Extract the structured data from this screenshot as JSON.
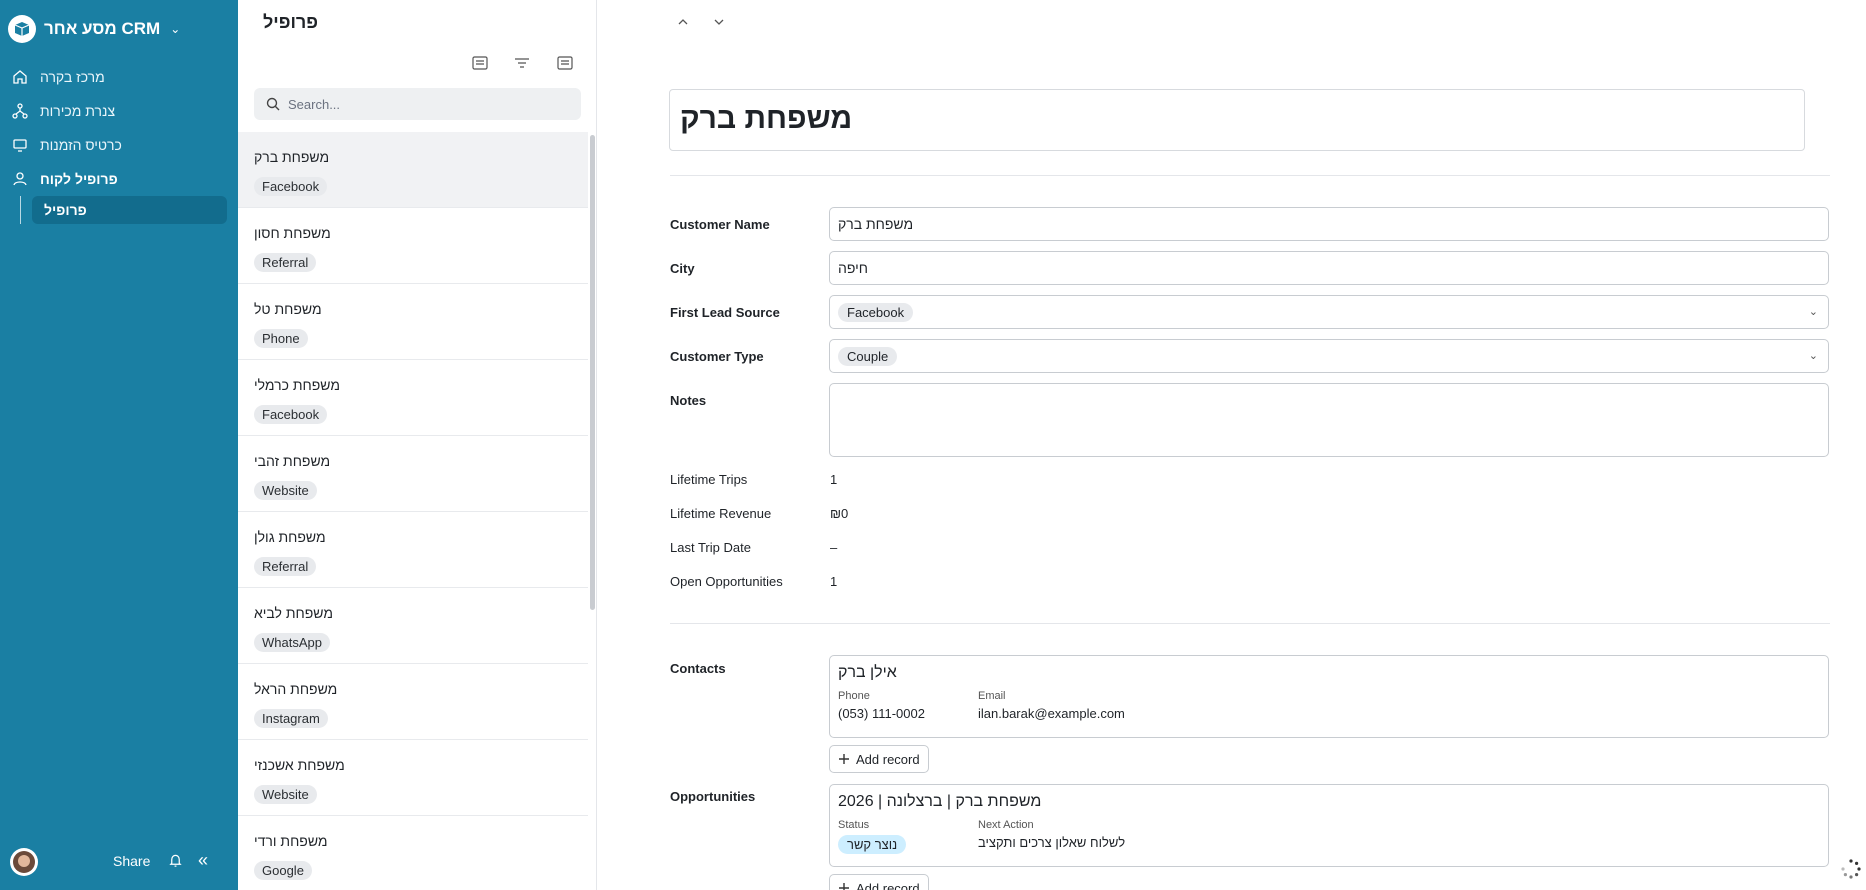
{
  "workspace": {
    "title": "מסע אחר CRM"
  },
  "nav": {
    "items": [
      {
        "label": "מרכז בקרה",
        "icon": "home-icon"
      },
      {
        "label": "צנרת מכירות",
        "icon": "pipeline-icon"
      },
      {
        "label": "כרטיס הזמנות",
        "icon": "monitor-icon"
      },
      {
        "label": "פרופיל לקוח",
        "icon": "user-icon"
      }
    ],
    "subitem": "פרופיל"
  },
  "footer": {
    "share": "Share"
  },
  "list": {
    "title": "פרופיל",
    "search_placeholder": "Search...",
    "items": [
      {
        "name": "משפחת ברק",
        "tag": "Facebook"
      },
      {
        "name": "משפחת חסון",
        "tag": "Referral"
      },
      {
        "name": "משפחת טל",
        "tag": "Phone"
      },
      {
        "name": "משפחת כרמלי",
        "tag": "Facebook"
      },
      {
        "name": "משפחת זהבי",
        "tag": "Website"
      },
      {
        "name": "משפחת גולן",
        "tag": "Referral"
      },
      {
        "name": "משפחת לביא",
        "tag": "WhatsApp"
      },
      {
        "name": "משפחת הראל",
        "tag": "Instagram"
      },
      {
        "name": "משפחת אשכנזי",
        "tag": "Website"
      },
      {
        "name": "משפחת ורדי",
        "tag": "Google"
      }
    ]
  },
  "detail": {
    "title": "משפחת ברק",
    "fields": {
      "customer_name_label": "Customer Name",
      "customer_name": "משפחת ברק",
      "city_label": "City",
      "city": "חיפה",
      "lead_source_label": "First Lead Source",
      "lead_source": "Facebook",
      "customer_type_label": "Customer Type",
      "customer_type": "Couple",
      "notes_label": "Notes",
      "notes": ""
    },
    "stats": {
      "trips_label": "Lifetime Trips",
      "trips": "1",
      "revenue_label": "Lifetime Revenue",
      "revenue": "₪0",
      "last_trip_label": "Last Trip Date",
      "last_trip": "–",
      "open_opps_label": "Open Opportunities",
      "open_opps": "1"
    },
    "contacts": {
      "label": "Contacts",
      "name": "אילן ברק",
      "phone_label": "Phone",
      "phone": "(053) 111-0002",
      "email_label": "Email",
      "email": "ilan.barak@example.com",
      "add_label": "Add record"
    },
    "opportunities": {
      "label": "Opportunities",
      "name": "משפחת ברק | ברצלונה | 2026",
      "status_label": "Status",
      "status": "נוצר קשר",
      "next_action_label": "Next Action",
      "next_action": "לשלוח שאלון צרכים ותקציב",
      "add_label": "Add record"
    }
  }
}
